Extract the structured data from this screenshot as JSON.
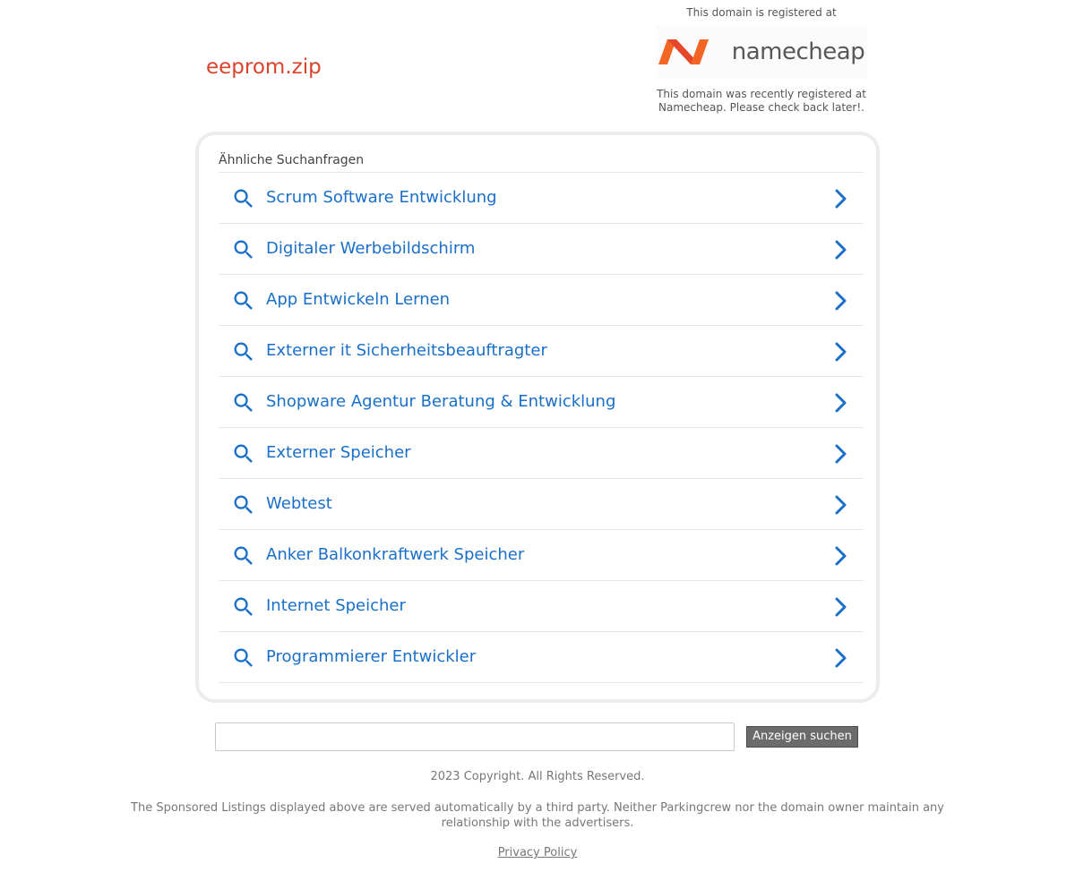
{
  "header": {
    "domain": "eeprom.zip"
  },
  "registrar": {
    "top_text": "This domain is registered at",
    "logo_name": "namecheap",
    "note": "This domain was recently registered at Namecheap. Please check back later!.",
    "logo_colors": [
      "#f26522",
      "#de3723"
    ]
  },
  "related": {
    "title": "Ähnliche Suchanfragen",
    "items": [
      {
        "label": "Scrum Software Entwicklung"
      },
      {
        "label": "Digitaler Werbebildschirm"
      },
      {
        "label": "App Entwickeln Lernen"
      },
      {
        "label": "Externer it Sicherheitsbeauftragter"
      },
      {
        "label": "Shopware Agentur Beratung & Entwicklung"
      },
      {
        "label": "Externer Speicher"
      },
      {
        "label": "Webtest"
      },
      {
        "label": "Anker Balkonkraftwerk Speicher"
      },
      {
        "label": "Internet Speicher"
      },
      {
        "label": "Programmierer Entwickler"
      }
    ],
    "link_color": "#1a6fc9",
    "icons": [
      "search-icon",
      "chevron-right-icon"
    ]
  },
  "search": {
    "input_value": "",
    "button_label": "Anzeigen suchen"
  },
  "footer": {
    "copyright": "2023 Copyright. All Rights Reserved.",
    "disclaimer": "The Sponsored Listings displayed above are served automatically by a third party. Neither Parkingcrew nor the domain owner maintain any relationship with the advertisers.",
    "privacy_label": "Privacy Policy"
  }
}
